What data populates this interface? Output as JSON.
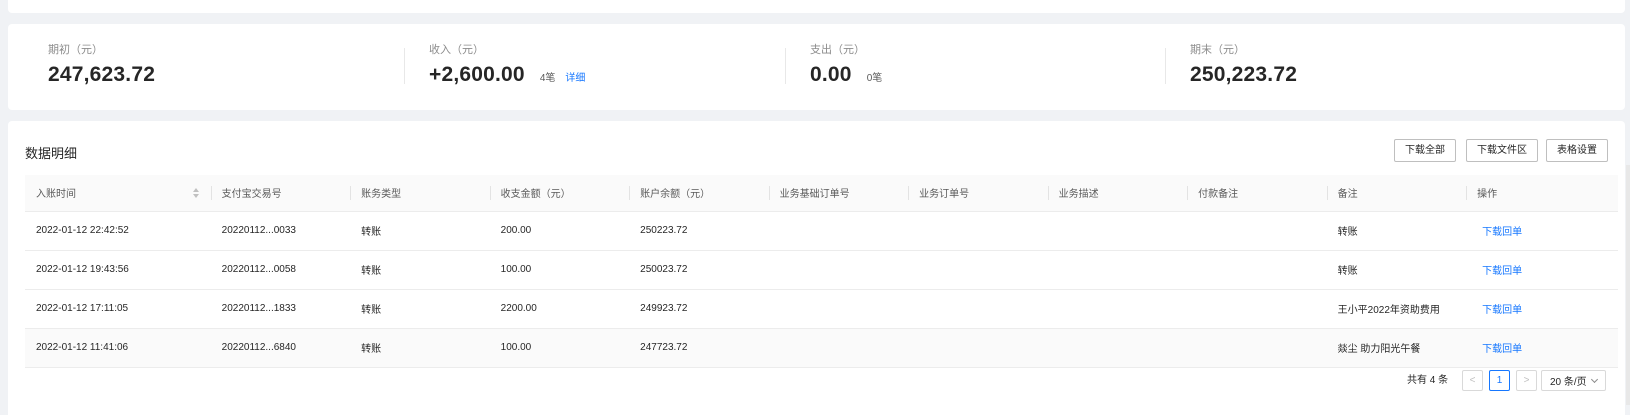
{
  "summary": {
    "opening": {
      "label": "期初（元）",
      "value": "247,623.72"
    },
    "income": {
      "label": "收入（元）",
      "value": "+2,600.00",
      "count": "4笔",
      "link": "详细"
    },
    "expense": {
      "label": "支出（元）",
      "value": "0.00",
      "count": "0笔"
    },
    "closing": {
      "label": "期末（元）",
      "value": "250,223.72"
    }
  },
  "detail": {
    "title": "数据明细",
    "buttons": {
      "download_all": "下载全部",
      "download_area": "下载文件区",
      "table_settings": "表格设置"
    }
  },
  "table": {
    "columns": [
      "入账时间",
      "支付宝交易号",
      "账务类型",
      "收支金额（元）",
      "账户余额（元）",
      "业务基础订单号",
      "业务订单号",
      "业务描述",
      "付款备注",
      "备注",
      "操作"
    ],
    "rows": [
      {
        "time": "2022-01-12 22:42:52",
        "trade_no": "20220112...0033",
        "type": "转账",
        "amount": "200.00",
        "balance": "250223.72",
        "base_order": "",
        "order": "",
        "desc": "",
        "pay_note": "",
        "note": "转账",
        "action": "下载回单"
      },
      {
        "time": "2022-01-12 19:43:56",
        "trade_no": "20220112...0058",
        "type": "转账",
        "amount": "100.00",
        "balance": "250023.72",
        "base_order": "",
        "order": "",
        "desc": "",
        "pay_note": "",
        "note": "转账",
        "action": "下载回单"
      },
      {
        "time": "2022-01-12 17:11:05",
        "trade_no": "20220112...1833",
        "type": "转账",
        "amount": "2200.00",
        "balance": "249923.72",
        "base_order": "",
        "order": "",
        "desc": "",
        "pay_note": "",
        "note": "王小平2022年资助费用",
        "action": "下载回单"
      },
      {
        "time": "2022-01-12 11:41:06",
        "trade_no": "20220112...6840",
        "type": "转账",
        "amount": "100.00",
        "balance": "247723.72",
        "base_order": "",
        "order": "",
        "desc": "",
        "pay_note": "",
        "note": "燚尘 助力阳光午餐",
        "action": "下载回单"
      }
    ]
  },
  "pagination": {
    "total": "共有 4 条",
    "prev": "<",
    "current": "1",
    "next": ">",
    "page_size": "20 条/页"
  }
}
